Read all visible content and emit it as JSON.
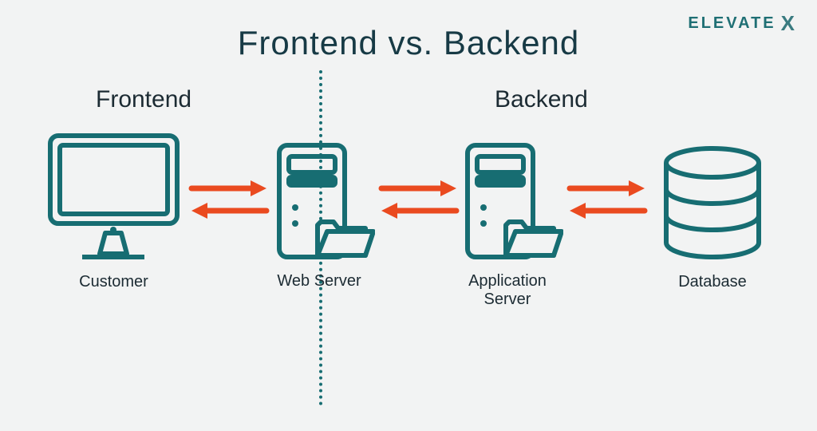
{
  "brand": {
    "name": "ELEVATE",
    "suffix": "X"
  },
  "title": "Frontend vs. Backend",
  "sections": {
    "frontend": "Frontend",
    "backend": "Backend"
  },
  "nodes": {
    "customer": {
      "label": "Customer"
    },
    "web": {
      "label": "Web Server"
    },
    "app": {
      "label": "Application Server"
    },
    "db": {
      "label": "Database"
    }
  },
  "colors": {
    "stroke": "#176d72",
    "arrow": "#ea4a1f",
    "bg": "#f2f3f3"
  }
}
